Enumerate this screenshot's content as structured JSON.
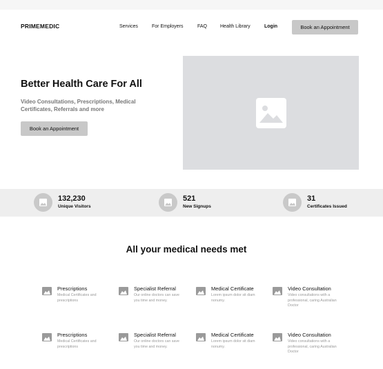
{
  "nav": {
    "logo": "PRIMEMEDIC",
    "links": [
      "Services",
      "For Employers",
      "FAQ",
      "Health Library"
    ],
    "login": "Login",
    "cta": "Book an Appointment"
  },
  "hero": {
    "title": "Better Health Care For All",
    "subtitle": "Video Consultations, Prescriptions, Medical Certificates, Referrals and more",
    "button": "Book an Appointment",
    "image_icon": "image-placeholder-icon"
  },
  "stats": [
    {
      "value": "132,230",
      "label": "Unique Visitors"
    },
    {
      "value": "521",
      "label": "New Signups"
    },
    {
      "value": "31",
      "label": "Certificates Issued"
    }
  ],
  "section_title": "All your medical needs met",
  "services": [
    {
      "title": "Prescriptions",
      "desc": "Medical Certificates and prescriptions"
    },
    {
      "title": "Specialist Referral",
      "desc": "Our online doctors can save you time and money."
    },
    {
      "title": "Medical Certificate",
      "desc": "Lorem ipsum dolor sit diam nonumy."
    },
    {
      "title": "Video Consultation",
      "desc": "Video consultations with a professional, caring Australian Doctor"
    },
    {
      "title": "Prescriptions",
      "desc": "Medical Certificates and prescriptions"
    },
    {
      "title": "Specialist Referral",
      "desc": "Our online doctors can save you time and money."
    },
    {
      "title": "Medical Certificate",
      "desc": "Lorem ipsum dolor sit diam nonumy."
    },
    {
      "title": "Video Consultation",
      "desc": "Video consultations with a professional, caring Australian Doctor"
    }
  ]
}
